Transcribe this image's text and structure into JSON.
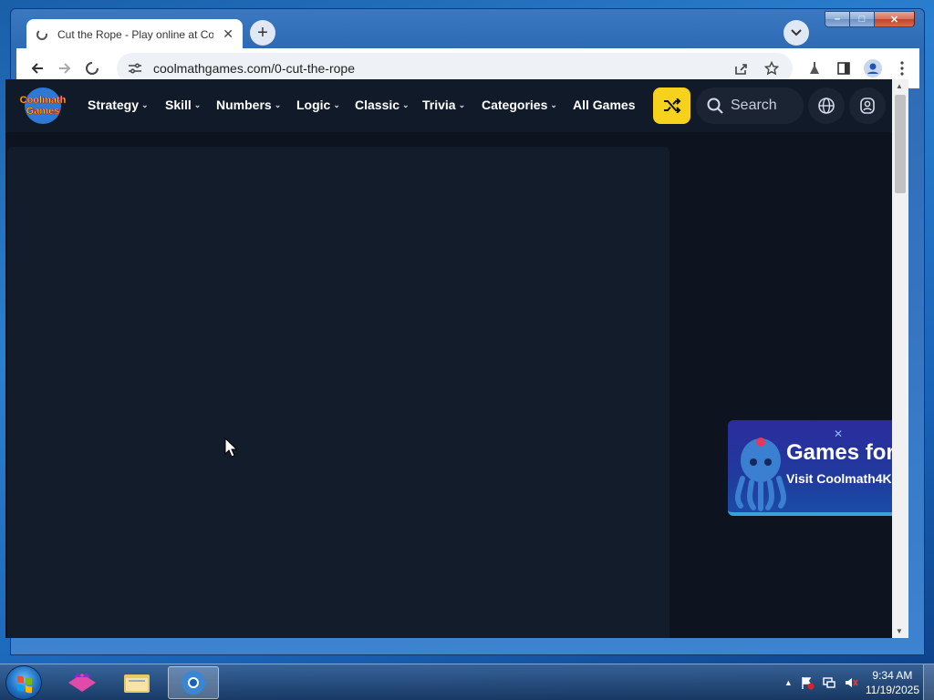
{
  "browser": {
    "tab_title": "Cut the Rope - Play online at Coolmath Games",
    "url": "coolmathgames.com/0-cut-the-rope"
  },
  "site": {
    "logo_text_1": "Coolmath",
    "logo_text_2": "Games",
    "nav": [
      {
        "label": "Strategy",
        "dropdown": true
      },
      {
        "label": "Skill",
        "dropdown": true
      },
      {
        "label": "Numbers",
        "dropdown": true
      },
      {
        "label": "Logic",
        "dropdown": true
      },
      {
        "label": "Classic",
        "dropdown": true
      },
      {
        "label": "Trivia",
        "dropdown": true
      },
      {
        "label": "Categories",
        "dropdown": true
      },
      {
        "label": "All Games",
        "dropdown": false
      }
    ],
    "search_placeholder": "Search",
    "promo": {
      "headline": "Games for",
      "subtext": "Visit Coolmath4K"
    }
  },
  "taskbar": {
    "time": "9:34 AM",
    "date": "11/19/2025"
  },
  "colors": {
    "page_bg": "#0d141f",
    "nav_bg": "#111a28",
    "shuffle_button": "#f7d21d"
  }
}
